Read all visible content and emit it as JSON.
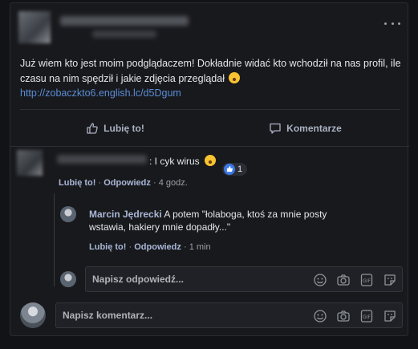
{
  "post": {
    "text": "Już wiem kto jest moim podglądaczem! Dokładnie widać kto wchodził na nas profil, ile czasu na nim spędził i jakie zdjęcia przeglądał",
    "link": "http://zobaczkto6.english.lc/d5Dgum"
  },
  "actions": {
    "like_label": "Lubię to!",
    "comment_label": "Komentarze"
  },
  "comment1": {
    "text": ": I cyk wirus",
    "reaction_count": "1",
    "like_label": "Lubię to!",
    "reply_label": "Odpowiedz",
    "time": "4 godz."
  },
  "reply1": {
    "author": "Marcin Jędrecki",
    "text": "A potem \"łolaboga, ktoś za mnie posty wstawia, hakiery mnie dopadły...\"",
    "like_label": "Lubię to!",
    "reply_label": "Odpowiedz",
    "time": "1 min"
  },
  "reply_input": {
    "placeholder": "Napisz odpowiedź..."
  },
  "comment_input": {
    "placeholder": "Napisz komentarz..."
  },
  "colors": {
    "accent": "#5b8cd6",
    "like_blue": "#3b78e7",
    "background": "#18191c"
  }
}
